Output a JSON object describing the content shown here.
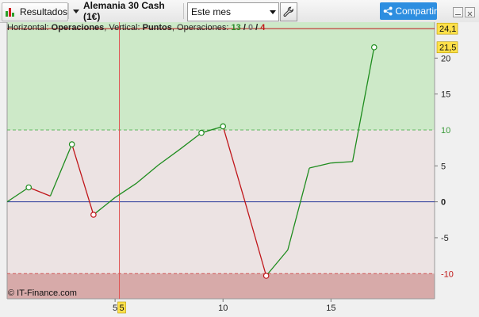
{
  "toolbar": {
    "results_label": "Resultados",
    "instrument_label": "Alemania 30 Cash (1€)",
    "period_value": "Este mes",
    "share_label": "Compartir"
  },
  "info": {
    "horizontal_label": "Horizontal:",
    "horizontal_value": "Operaciones",
    "vertical_label": "Vertical:",
    "vertical_value": "Puntos",
    "ops_label": "Operaciones:",
    "ops_win": "13",
    "ops_slash1": "/",
    "ops_zero": "0",
    "ops_slash2": "/",
    "ops_loss": "4"
  },
  "copyright": "© IT-Finance.com",
  "colors": {
    "win_line": "#1e8c1e",
    "loss_line": "#c0161a",
    "zero_line": "#2a3a9a",
    "profit_zone": "#cde9c8",
    "loss_zone": "#d7aaa9",
    "neutral_zone": "#ece3e3",
    "cursor_line": "#e05050"
  },
  "chart_data": {
    "type": "line",
    "x": [
      0,
      1,
      2,
      3,
      4,
      5,
      6,
      7,
      8,
      9,
      10,
      11,
      12,
      13,
      14,
      15,
      16,
      17
    ],
    "y": [
      0,
      2,
      0.8,
      8,
      -1.8,
      0.6,
      2.6,
      5.1,
      7.3,
      9.6,
      10.5,
      0.2,
      -10.3,
      -6.7,
      4.7,
      5.4,
      5.6,
      21.5
    ],
    "segment_colors": [
      "green",
      "red",
      "green",
      "red",
      "green",
      "green",
      "green",
      "green",
      "green",
      "green",
      "red",
      "red",
      "green",
      "green",
      "green",
      "green",
      "green"
    ],
    "markers": [
      {
        "x": 1,
        "y": 2,
        "color": "green"
      },
      {
        "x": 3,
        "y": 8,
        "color": "green"
      },
      {
        "x": 4,
        "y": -1.8,
        "color": "red"
      },
      {
        "x": 9,
        "y": 9.6,
        "color": "green"
      },
      {
        "x": 10,
        "y": 10.5,
        "color": "green"
      },
      {
        "x": 12,
        "y": -10.3,
        "color": "red"
      },
      {
        "x": 17,
        "y": 21.5,
        "color": "green"
      }
    ],
    "xlim": [
      0,
      19.8
    ],
    "ylim": [
      -13.5,
      25
    ],
    "x_ticks": [
      "5",
      "10",
      "15"
    ],
    "x_tick_values": [
      5,
      10,
      15
    ],
    "y_ticks": [
      "20",
      "15",
      "5",
      "0",
      "-5"
    ],
    "y_tick_values": [
      20,
      15,
      5,
      0,
      -5
    ],
    "hlines": [
      {
        "y": 24.1,
        "label": "24,1",
        "style": "solid",
        "color": "red",
        "badge": true
      },
      {
        "y": 21.5,
        "label": "21,5",
        "style": "none",
        "color": "green",
        "badge": true
      },
      {
        "y": 10,
        "label": "10",
        "style": "dashed",
        "color": "green",
        "badge": false
      },
      {
        "y": 0,
        "label": "0",
        "style": "solid",
        "color": "blue",
        "badge": false
      },
      {
        "y": -10,
        "label": "-10",
        "style": "dashed",
        "color": "red",
        "badge": false
      }
    ],
    "cursor_x": 5.2,
    "cursor_label": "5",
    "grid": false
  }
}
